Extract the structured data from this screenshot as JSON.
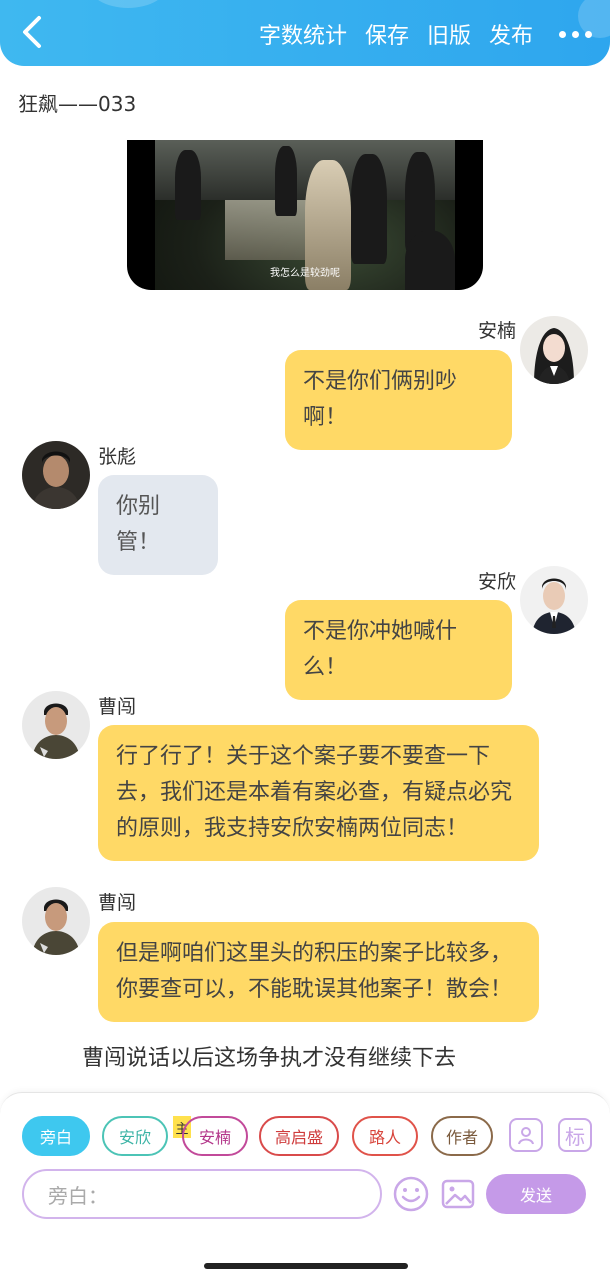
{
  "header": {
    "back_icon": "chevron-left-icon",
    "actions": [
      "字数统计",
      "保存",
      "旧版",
      "发布"
    ],
    "more_icon": "more-dots-icon",
    "bg_color": "#35aef0"
  },
  "doc_title": "狂飙——033",
  "video": {
    "subtitle": "我怎么是较劲呢"
  },
  "messages": [
    {
      "side": "right",
      "name": "安楠",
      "text": "不是你们俩别吵啊！",
      "color": "yellow"
    },
    {
      "side": "left",
      "name": "张彪",
      "text": "你别管！",
      "color": "gray"
    },
    {
      "side": "right",
      "name": "安欣",
      "text": "不是你冲她喊什么！",
      "color": "yellow"
    },
    {
      "side": "left",
      "name": "曹闯",
      "lines": [
        "行了行了！关于这个案子要不要查一下",
        "去，我们还是本着有案必查，有疑点必究",
        "的原则，我支持安欣安楠两位同志！"
      ],
      "color": "yellow"
    },
    {
      "side": "left",
      "name": "曹闯",
      "lines": [
        "但是啊咱们这里头的积压的案子比较多，",
        "你要查可以，不能耽误其他案子！散会！"
      ],
      "color": "yellow"
    }
  ],
  "narration": "曹闯说话以后这场争执才没有继续下去",
  "roles": {
    "chips": [
      "旁白",
      "安欣",
      "安楠",
      "高启盛",
      "路人",
      "作者"
    ],
    "active": "旁白",
    "host_badge": "主",
    "tag_label": "标"
  },
  "composer": {
    "placeholder": "旁白：",
    "send_label": "发送"
  },
  "colors": {
    "yellow_bubble": "#ffd966",
    "gray_bubble": "#e3e8ef",
    "accent_purple": "#c59ae8",
    "accent_cyan": "#3ec8ef"
  }
}
